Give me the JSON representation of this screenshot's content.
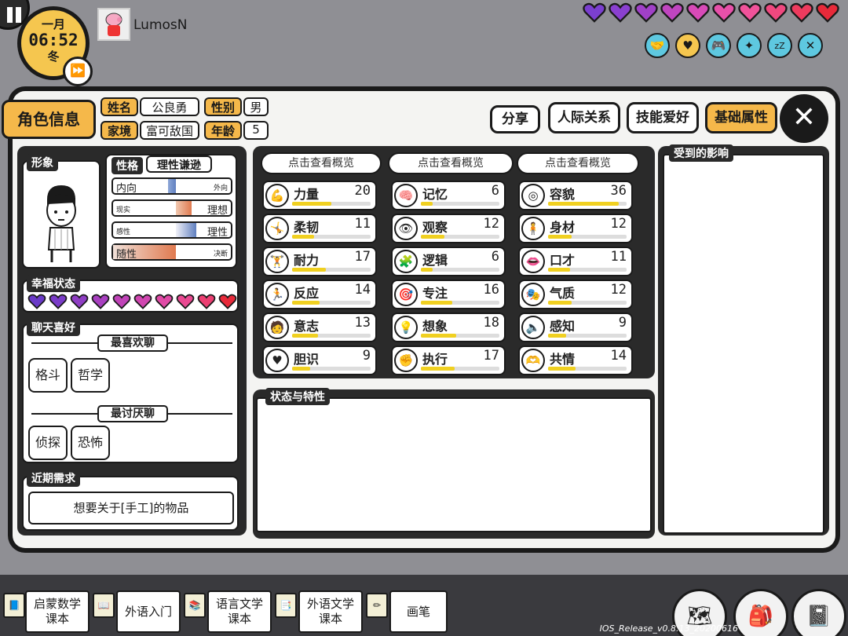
{
  "hud": {
    "month": "一月",
    "time": "06:52",
    "season": "冬",
    "player_name": "LumosN",
    "hearts_top": [
      "#7b3fd0",
      "#8a40d0",
      "#a040c8",
      "#c045c0",
      "#d84ab8",
      "#e850aa",
      "#f0529a",
      "#f0487f",
      "#ee3b5e",
      "#e82a3a"
    ],
    "status_icons": [
      "handshake-icon",
      "heart-icon",
      "gamepad-icon",
      "sparkle-icon",
      "sleep-icon",
      "food-icon"
    ]
  },
  "header": {
    "title": "角色信息",
    "name_label": "姓名",
    "name_value": "公良勇",
    "gender_label": "性别",
    "gender_value": "男",
    "family_label": "家境",
    "family_value": "富可敌国",
    "age_label": "年龄",
    "age_value": "5",
    "share_btn": "分享",
    "tab_relations": "人际关系",
    "tab_skills": "技能爱好",
    "tab_basic": "基础属性"
  },
  "profile": {
    "portrait_label": "形象",
    "personality_label": "性格",
    "personality_value": "理性谦逊",
    "traits": [
      {
        "left": "内向",
        "right": "外向"
      },
      {
        "left": "现实",
        "right": "理想"
      },
      {
        "left": "感性",
        "right": "理性"
      },
      {
        "left": "随性",
        "right": "决断"
      }
    ],
    "happiness_label": "幸福状态",
    "happiness_hearts": [
      "#6a3ac8",
      "#7a3cc8",
      "#8f3ec4",
      "#a840c0",
      "#c043b8",
      "#d046b0",
      "#e04aa6",
      "#ea4a92",
      "#ec3f72",
      "#e82a3a"
    ],
    "chat_label": "聊天喜好",
    "likes_label": "最喜欢聊",
    "likes": [
      "格斗",
      "哲学"
    ],
    "dislikes_label": "最讨厌聊",
    "dislikes": [
      "侦探",
      "恐怖"
    ],
    "needs_label": "近期需求",
    "needs_value": "想要关于[手工]的物品"
  },
  "stats": {
    "overview_btn": "点击查看概览",
    "columns": [
      [
        {
          "name": "力量",
          "value": 20,
          "icon": "muscle-icon"
        },
        {
          "name": "柔韧",
          "value": 11,
          "icon": "stretch-icon"
        },
        {
          "name": "耐力",
          "value": 17,
          "icon": "weightlift-icon"
        },
        {
          "name": "反应",
          "value": 14,
          "icon": "run-icon"
        },
        {
          "name": "意志",
          "value": 13,
          "icon": "person-icon"
        },
        {
          "name": "胆识",
          "value": 9,
          "icon": "heart-icon"
        }
      ],
      [
        {
          "name": "记忆",
          "value": 6,
          "icon": "brain-icon"
        },
        {
          "name": "观察",
          "value": 12,
          "icon": "eye-icon"
        },
        {
          "name": "逻辑",
          "value": 6,
          "icon": "puzzle-icon"
        },
        {
          "name": "专注",
          "value": 16,
          "icon": "target-icon"
        },
        {
          "name": "想象",
          "value": 18,
          "icon": "bulb-icon"
        },
        {
          "name": "执行",
          "value": 17,
          "icon": "fist-icon"
        }
      ],
      [
        {
          "name": "容貌",
          "value": 36,
          "icon": "mirror-icon"
        },
        {
          "name": "身材",
          "value": 12,
          "icon": "body-icon"
        },
        {
          "name": "口才",
          "value": 11,
          "icon": "lips-icon"
        },
        {
          "name": "气质",
          "value": 12,
          "icon": "mask-icon"
        },
        {
          "name": "感知",
          "value": 9,
          "icon": "sense-icon"
        },
        {
          "name": "共情",
          "value": 14,
          "icon": "hands-heart-icon"
        }
      ]
    ],
    "bar_max": 40
  },
  "traits_panel": {
    "label": "状态与特性"
  },
  "effects_panel": {
    "label": "受到的影响"
  },
  "bottom": {
    "books": [
      "启蒙数学\n课本",
      "外语入门",
      "语言文学\n课本",
      "外语文学\n课本",
      "画笔"
    ],
    "version": "IOS_Release_v0.8.13_20200616"
  }
}
